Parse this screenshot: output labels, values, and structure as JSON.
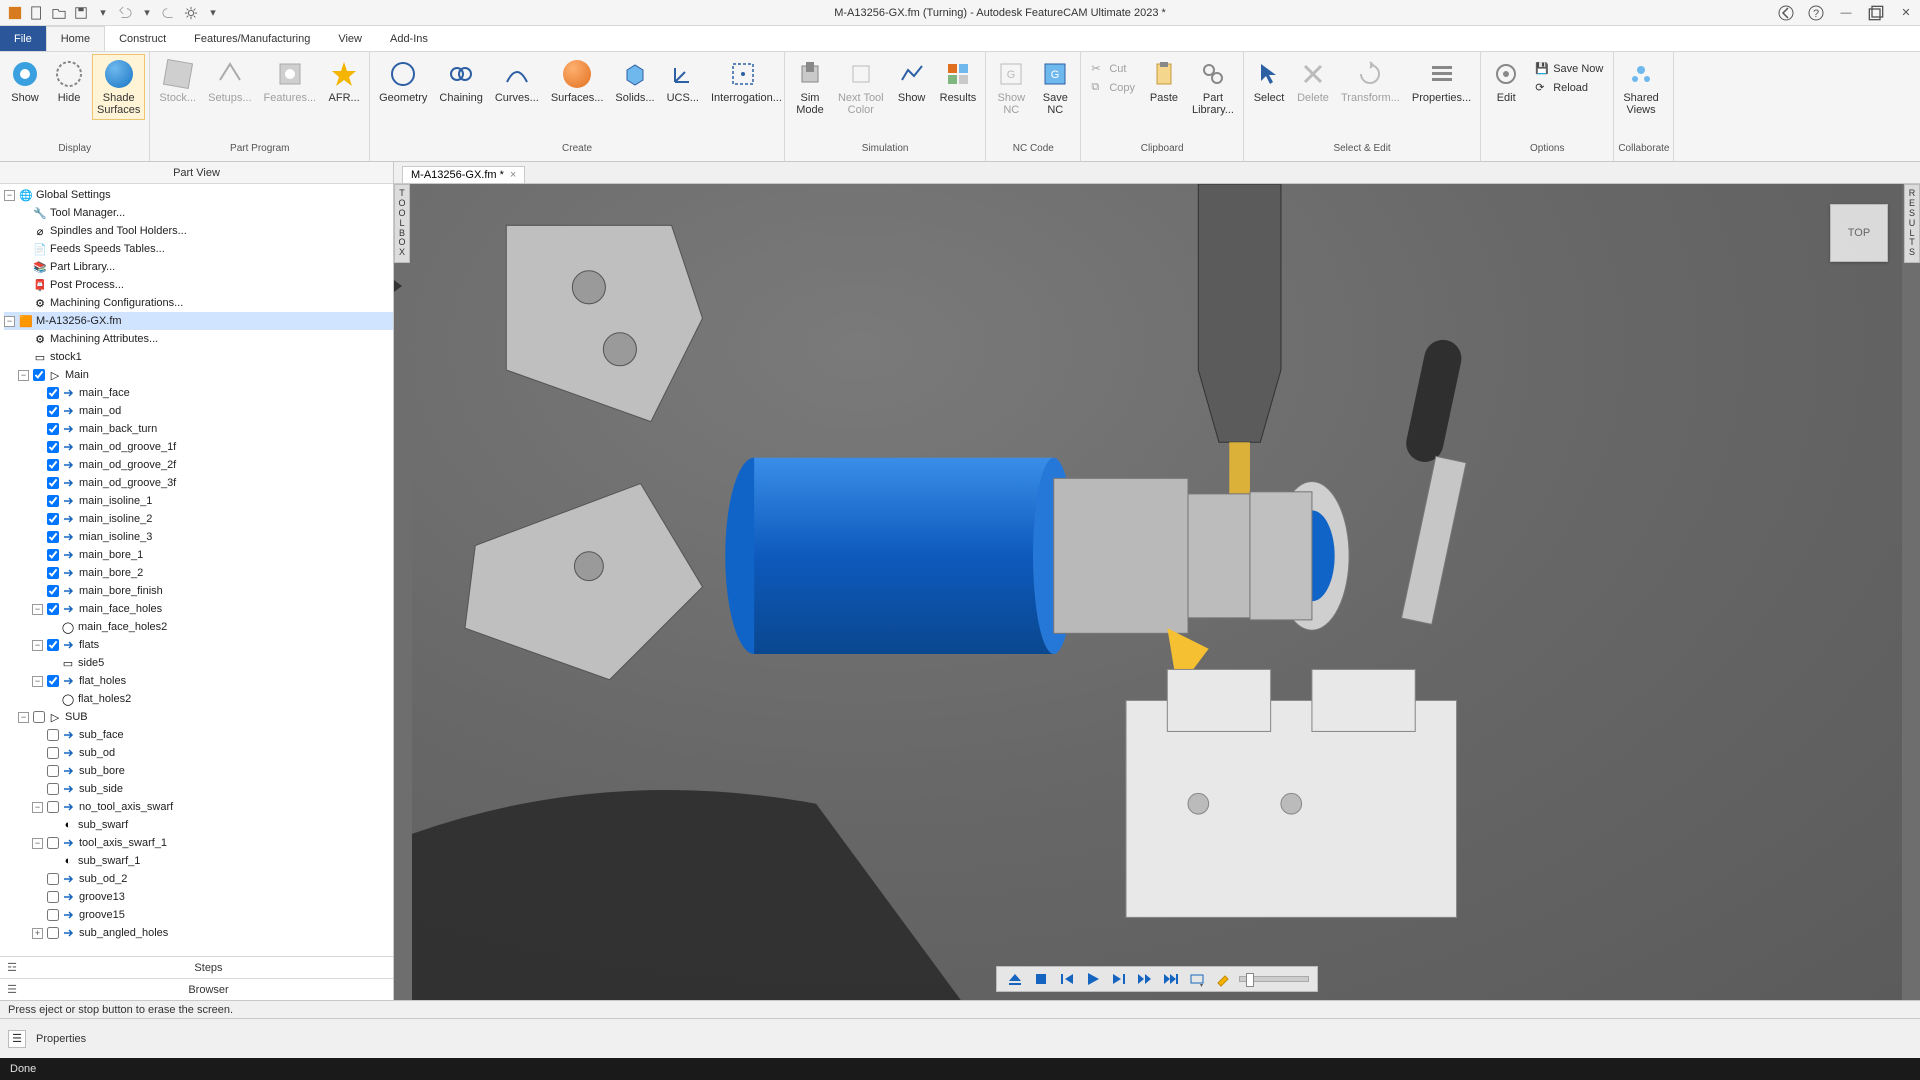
{
  "title": "M-A13256-GX.fm (Turning) - Autodesk FeatureCAM Ultimate 2023 *",
  "tabs": {
    "file": "File",
    "home": "Home",
    "construct": "Construct",
    "fm": "Features/Manufacturing",
    "view": "View",
    "addins": "Add-Ins"
  },
  "ribbon": {
    "display": {
      "label": "Display",
      "show": "Show",
      "hide": "Hide",
      "shade": "Shade\nSurfaces"
    },
    "partprog": {
      "label": "Part Program",
      "stock": "Stock...",
      "setups": "Setups...",
      "features": "Features...",
      "afr": "AFR..."
    },
    "create": {
      "label": "Create",
      "geom": "Geometry",
      "chain": "Chaining",
      "curves": "Curves...",
      "surf": "Surfaces...",
      "solids": "Solids...",
      "ucs": "UCS...",
      "interrog": "Interrogation..."
    },
    "sim": {
      "label": "Simulation",
      "simmode": "Sim\nMode",
      "nexttool": "Next Tool\nColor",
      "show": "Show",
      "results": "Results"
    },
    "nccode": {
      "label": "NC Code",
      "shownc": "Show\nNC",
      "savenc": "Save\nNC"
    },
    "clipboard": {
      "label": "Clipboard",
      "cut": "Cut",
      "copy": "Copy",
      "paste": "Paste",
      "partlib": "Part\nLibrary..."
    },
    "selectedit": {
      "label": "Select & Edit",
      "select": "Select",
      "delete": "Delete",
      "transform": "Transform...",
      "properties": "Properties..."
    },
    "options": {
      "label": "Options",
      "edit": "Edit",
      "savenow": "Save Now",
      "reload": "Reload"
    },
    "collab": {
      "label": "Collaborate",
      "shared": "Shared\nViews"
    }
  },
  "partview": {
    "title": "Part View"
  },
  "tree": {
    "root": "Global Settings",
    "tool": "Tool Manager...",
    "spindles": "Spindles and Tool Holders...",
    "feeds": "Feeds  Speeds Tables...",
    "partlib": "Part Library...",
    "postproc": "Post Process...",
    "machcfg": "Machining Configurations...",
    "file": "M-A13256-GX.fm",
    "machattr": "Machining Attributes...",
    "stock": "stock1",
    "main": "Main",
    "features": [
      "main_face",
      "main_od",
      "main_back_turn",
      "main_od_groove_1f",
      "main_od_groove_2f",
      "main_od_groove_3f",
      "main_isoline_1",
      "main_isoline_2",
      "mian_isoline_3",
      "main_bore_1",
      "main_bore_2",
      "main_bore_finish"
    ],
    "mfh": "main_face_holes",
    "mfh2": "main_face_holes2",
    "flats": "flats",
    "side5": "side5",
    "flatholes": "flat_holes",
    "flatholes2": "flat_holes2",
    "sub": "SUB",
    "subf": [
      "sub_face",
      "sub_od",
      "sub_bore",
      "sub_side"
    ],
    "noswarf": "no_tool_axis_swarf",
    "subswarf": "sub_swarf",
    "toolswarf": "tool_axis_swarf_1",
    "subswarf1": "sub_swarf_1",
    "subod2": "sub_od_2",
    "g13": "groove13",
    "g15": "groove15",
    "sah": "sub_angled_holes"
  },
  "leftfooter": {
    "steps": "Steps",
    "browser": "Browser"
  },
  "doctab": {
    "name": "M-A13256-GX.fm *"
  },
  "viewport": {
    "toolbox": "T\nO\nO\nL\nB\nO\nX",
    "results": "R\nE\nS\nU\nL\nT\nS",
    "viewcube": "TOP"
  },
  "hint": "Press eject or stop button to erase the screen.",
  "propbar": "Properties",
  "status": "Done"
}
